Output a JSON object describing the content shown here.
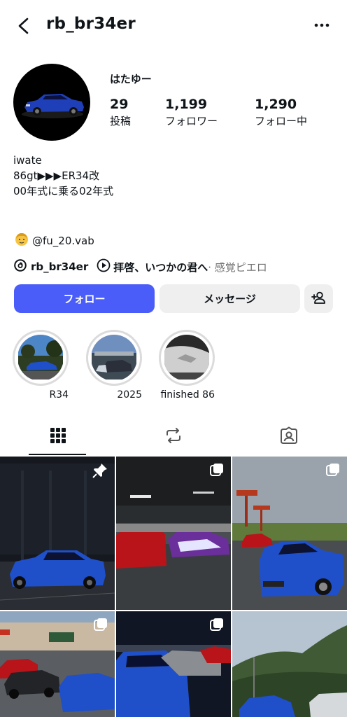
{
  "header": {
    "username": "rb_br34er"
  },
  "profile": {
    "display_name": "はたゆー",
    "stats": [
      {
        "value": "29",
        "label": "投稿"
      },
      {
        "value": "1,199",
        "label": "フォロワー"
      },
      {
        "value": "1,290",
        "label": "フォロー中"
      }
    ],
    "bio_lines": [
      "iwate",
      "86gt▶▶▶ER34改",
      "00年式に乗る02年式"
    ],
    "mention": "@fu_20.vab",
    "threads_handle": "rb_br34er",
    "music_title": "拝啓、いつかの君へ",
    "music_artist": " · 感覚ピエロ"
  },
  "actions": {
    "follow": "フォロー",
    "message": "メッセージ"
  },
  "highlights": [
    {
      "label": "R34"
    },
    {
      "label": "2025"
    },
    {
      "label": "finished 86"
    }
  ],
  "tabs": [
    "posts-grid-icon",
    "reels-repost-icon",
    "tagged-icon"
  ],
  "colors": {
    "follow_button": "#4a5df9",
    "secondary_button": "#efefef",
    "car_blue": "#1f4fc9"
  }
}
